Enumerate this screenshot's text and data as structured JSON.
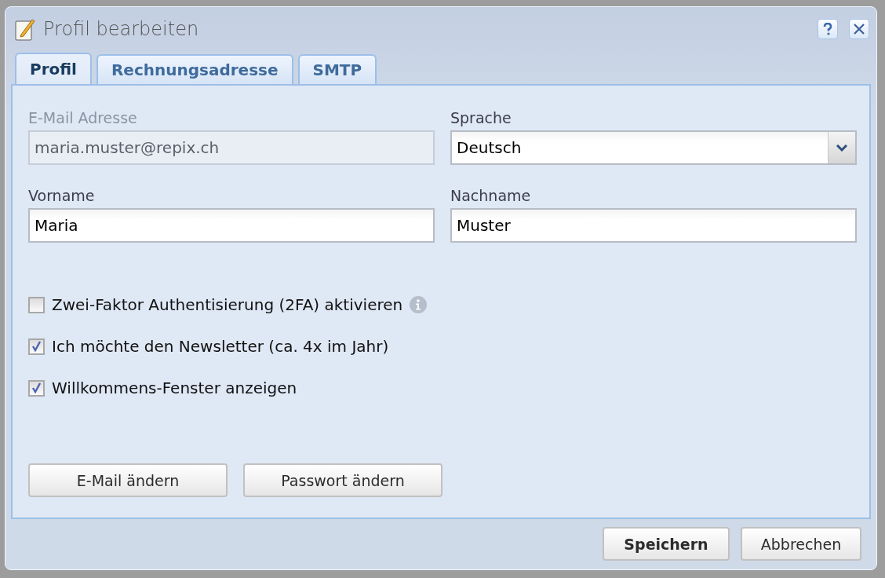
{
  "window": {
    "title": "Profil bearbeiten"
  },
  "tabs": [
    {
      "label": "Profil",
      "selected": true
    },
    {
      "label": "Rechnungsadresse",
      "selected": false
    },
    {
      "label": "SMTP",
      "selected": false
    }
  ],
  "fields": [
    {
      "label": "E-Mail Adresse",
      "value": "maria.muster@repix.ch",
      "kind": "text",
      "disabled": true
    },
    {
      "label": "Sprache",
      "value": "Deutsch",
      "kind": "select",
      "disabled": false
    },
    {
      "label": "Vorname",
      "value": "Maria",
      "kind": "text",
      "disabled": false
    },
    {
      "label": "Nachname",
      "value": "Muster",
      "kind": "text",
      "disabled": false
    }
  ],
  "checkboxes": [
    {
      "label": "Zwei-Faktor Authentisierung (2FA) aktivieren",
      "checked": false,
      "info": true
    },
    {
      "label": "Ich möchte den Newsletter (ca. 4x im Jahr)",
      "checked": true,
      "info": false
    },
    {
      "label": "Willkommens-Fenster anzeigen",
      "checked": true,
      "info": false
    }
  ],
  "panel_buttons": [
    "E-Mail ändern",
    "Passwort ändern"
  ],
  "footer_buttons": [
    {
      "label": "Speichern",
      "primary": true
    },
    {
      "label": "Abbrechen",
      "primary": false
    }
  ]
}
